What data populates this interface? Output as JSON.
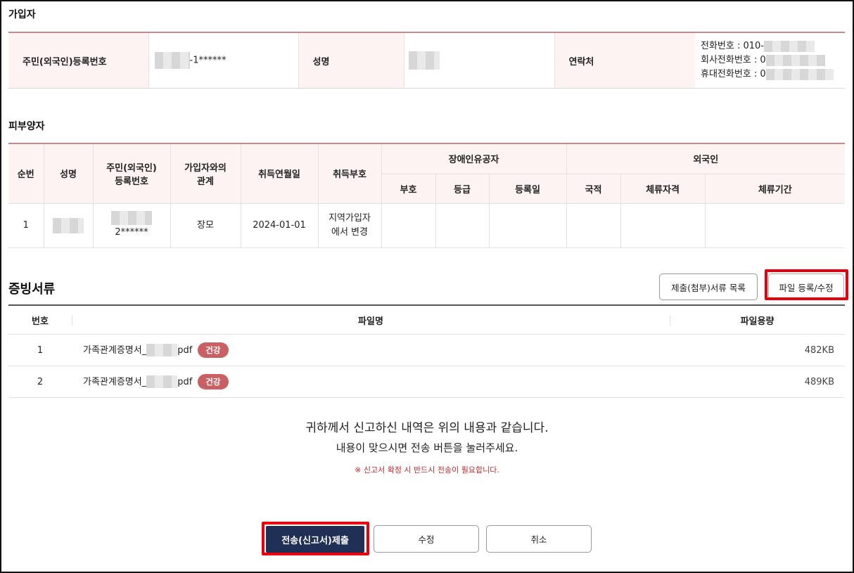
{
  "subscriber": {
    "section_title": "가입자",
    "reg_no_label": "주민(외국인)등록번호",
    "reg_no_value": "-1******",
    "name_label": "성명",
    "contact_label": "연락처",
    "phone": "전화번호 : 010-",
    "company_phone": "회사전화번호 : 0",
    "mobile_phone": "휴대전화번호 : 0"
  },
  "dependents": {
    "section_title": "피부양자",
    "headers": {
      "seq": "순번",
      "name": "성명",
      "reg_no_line1": "주민(외국인)",
      "reg_no_line2": "등록번호",
      "relation_line1": "가입자와의",
      "relation_line2": "관계",
      "acq_date": "취득연월일",
      "acq_code": "취득부호",
      "disabled_group": "장애인유공자",
      "dis_code": "부호",
      "dis_grade": "등급",
      "dis_reg_date": "등록일",
      "foreigner_group": "외국인",
      "nationality": "국적",
      "stay_status": "체류자격",
      "stay_period": "체류기간"
    },
    "rows": [
      {
        "seq": "1",
        "reg_no_tail": "2******",
        "relation": "장모",
        "acq_date": "2024-01-01",
        "acq_code_line1": "지역가입자",
        "acq_code_line2": "에서 변경"
      }
    ]
  },
  "documents": {
    "section_title": "증빙서류",
    "list_button": "제출(첨부)서류 목록",
    "register_button": "파일 등록/수정",
    "headers": {
      "no": "번호",
      "filename": "파일명",
      "size": "파일용량"
    },
    "rows": [
      {
        "no": "1",
        "name_prefix": "가족관계증명서_",
        "name_suffix": "pdf",
        "badge": "건강",
        "size": "482KB"
      },
      {
        "no": "2",
        "name_prefix": "가족관계증명서_",
        "name_suffix": "pdf",
        "badge": "건강",
        "size": "489KB"
      }
    ]
  },
  "message": {
    "line1": "귀하께서 신고하신 내역은 위의 내용과 같습니다.",
    "line2": "내용이 맞으시면 전송 버튼을 눌러주세요.",
    "note": "※ 신고서 확정 시 반드시 전송이 필요합니다."
  },
  "actions": {
    "submit": "전송(신고서)제출",
    "edit": "수정",
    "cancel": "취소"
  },
  "colors": {
    "accent_red": "#e8000e",
    "navy": "#1f2f55",
    "badge": "#c96064",
    "table_head": "#fdf3f3"
  }
}
